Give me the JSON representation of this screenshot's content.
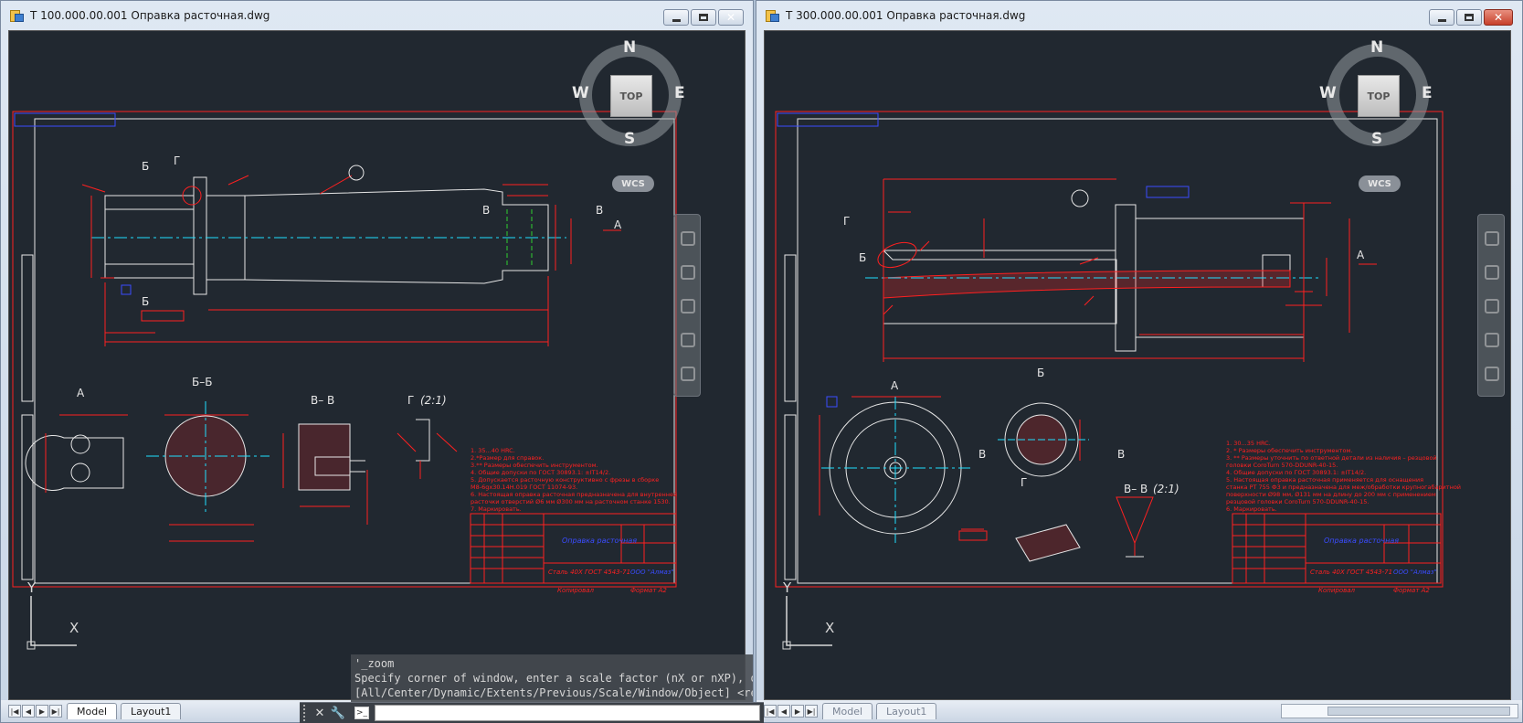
{
  "windows": [
    {
      "title": "Т 100.000.00.001 Оправка расточная.dwg",
      "tabs": {
        "model": "Model",
        "layout": "Layout1"
      },
      "viewcube": {
        "n": "N",
        "s": "S",
        "e": "E",
        "w": "W",
        "top": "TOP"
      },
      "wcs": "WCS",
      "ucs": {
        "x": "X",
        "y": "Y"
      },
      "labels": {
        "section_a": "А",
        "section_bb": "Б–Б",
        "section_vv": "В– В",
        "detail_g": "Г",
        "detail_g_scale": "(2:1)",
        "cut_b1": "Б",
        "cut_g": "Г",
        "cut_v1": "В",
        "cut_v2": "В",
        "view_a": "А",
        "cut_b2": "Б"
      },
      "notes": [
        "1. 35...40 HRC.",
        "2.*Размер для справок.",
        "3.** Размеры обеспечить инструментом.",
        "4. Общие допуски по ГОСТ 30893.1: ±IT14/2.",
        "5. Допускается расточную конструктивно с фрезы в сборке",
        "М8-6gх30.14Н.019 ГОСТ 11074-93.",
        "6. Настоящая оправка расточная предназначена для внутренней",
        "расточки отверстий Ø6 мм Ø300 мм на расточном станке 1530.",
        "7. Маркировать."
      ],
      "stamp": {
        "name": "Оправка расточная",
        "material": "Сталь 40Х ГОСТ 4543-71",
        "company": "ООО \"Алмаз\"",
        "format_label": "Копировал",
        "format": "Формат А2"
      }
    },
    {
      "title": "Т 300.000.00.001 Оправка расточная.dwg",
      "tabs": {
        "model": "Model",
        "layout": "Layout1"
      },
      "viewcube": {
        "n": "N",
        "s": "S",
        "e": "E",
        "w": "W",
        "top": "TOP"
      },
      "wcs": "WCS",
      "ucs": {
        "x": "X",
        "y": "Y"
      },
      "labels": {
        "section_a": "А",
        "section_b": "Б",
        "section_vv": "В– В",
        "section_vv_scale": "(2:1)",
        "detail_g": "Г",
        "cut_g": "Г",
        "cut_b": "Б",
        "view_a": "А",
        "cut_v1": "В",
        "cut_v2": "В"
      },
      "notes": [
        "1. 30...35 HRC.",
        "2. * Размеры обеспечить инструментом.",
        "3. ** Размеры уточнить по ответной детали из наличия – резцовой",
        "головки CoroTurn 570-DDUNR-40-15.",
        "4. Общие допуски по ГОСТ 30893.1: ±IT14/2.",
        "5. Настоящая оправка расточная применяется для оснащения",
        "станка РТ 755 Ф3 и предназначена для меж/обработки крупногабаритной",
        "поверхности Ø98 мм, Ø131 мм на длину до 200 мм с применением",
        "резцовой головки CoroTurn 570-DDUNR-40-15.",
        "6. Маркировать."
      ],
      "stamp": {
        "name": "Оправка расточная",
        "material": "Сталь 40Х ГОСТ 4543-71",
        "company": "ООО \"Алмаз\"",
        "format_label": "Копировал",
        "format": "Формат А2"
      }
    }
  ],
  "command_line": {
    "history": [
      "'_zoom",
      "Specify corner of window, enter a scale factor (nX or nXP), or",
      "[All/Center/Dynamic/Extents/Previous/Scale/Window/Object] <real time>: _e"
    ],
    "input_placeholder": ""
  },
  "colors": {
    "viewport_bg": "#212830",
    "drawing_red": "#ff2020",
    "drawing_white": "#e6e6e6",
    "drawing_cyan": "#20e0ff",
    "drawing_green": "#30d030",
    "drawing_blue": "#3a4cff"
  }
}
